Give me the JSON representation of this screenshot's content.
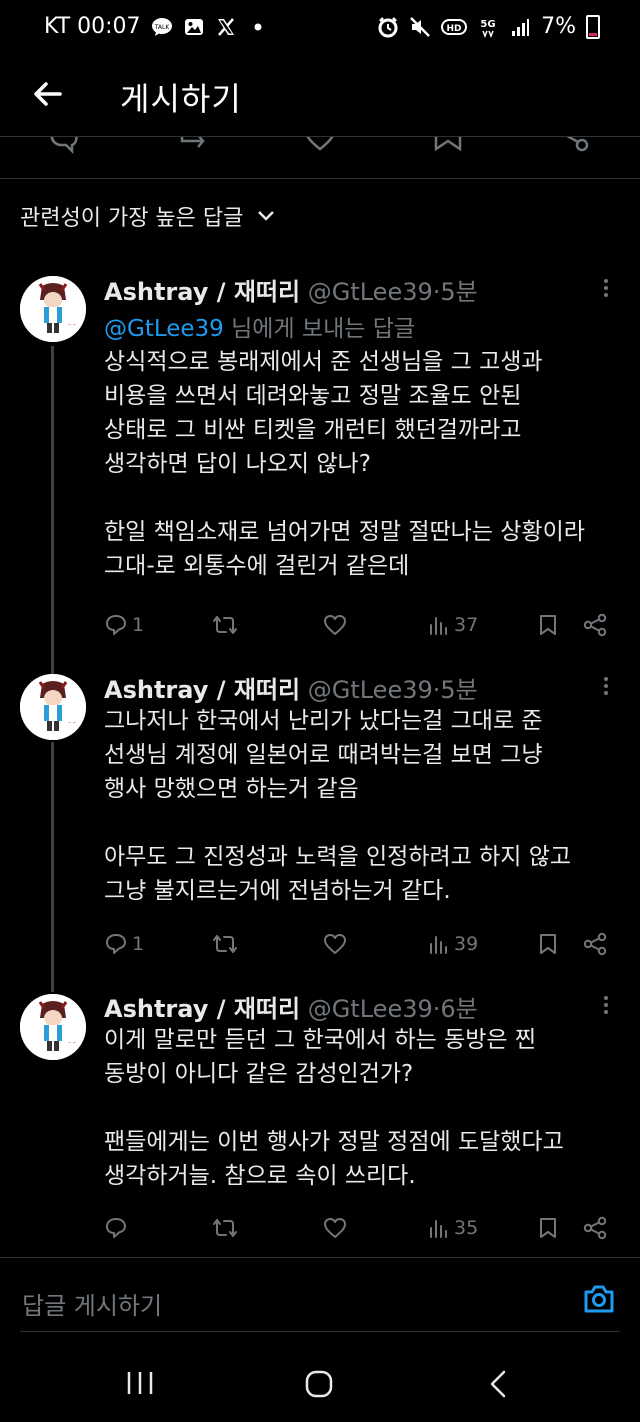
{
  "status_bar": {
    "carrier_time": "KT 00:07",
    "battery": "7%",
    "left_icons": [
      "talk-icon",
      "image-icon",
      "x-icon",
      "dot-icon"
    ],
    "right_icons": [
      "alarm-icon",
      "mute-icon",
      "hd-icon",
      "5g-icon",
      "signal-icon",
      "battery-icon"
    ]
  },
  "header": {
    "title": "게시하기"
  },
  "sort": {
    "label": "관련성이 가장 높은 답글"
  },
  "tweets": [
    {
      "name": "Ashtray / 재떠리",
      "handle": "@GtLee39",
      "dot": "·",
      "time": "5분",
      "reply_to": {
        "mention": "@GtLee39",
        "suffix": " 님에게 보내는 답글"
      },
      "lines": [
        "상식적으로 봉래제에서 준 선생님을 그 고생과",
        "비용을 쓰면서 데려와놓고 정말 조율도 안된",
        "상태로 그 비싼 티켓을 개런티 했던걸까라고",
        "생각하면 답이 나오지 않나?",
        "",
        "한일 책임소재로 넘어가면 정말 절딴나는 상황이라",
        "그대-로 외통수에 걸린거 같은데"
      ],
      "replies": "1",
      "views": "37"
    },
    {
      "name": "Ashtray / 재떠리",
      "handle": "@GtLee39",
      "dot": "·",
      "time": "5분",
      "lines": [
        "그나저나 한국에서 난리가 났다는걸 그대로 준",
        "선생님 계정에 일본어로 때려박는걸 보면 그냥",
        "행사 망했으면 하는거 같음",
        "",
        "아무도 그 진정성과 노력을 인정하려고 하지 않고",
        "그냥 불지르는거에 전념하는거 같다."
      ],
      "replies": "1",
      "views": "39"
    },
    {
      "name": "Ashtray / 재떠리",
      "handle": "@GtLee39",
      "dot": "·",
      "time": "6분",
      "lines": [
        "이게 말로만 듣던 그 한국에서 하는 동방은 찐",
        "동방이 아니다 같은 감성인건가?",
        "",
        "팬들에게는 이번 행사가 정말 정점에 도달했다고",
        "생각하거늘. 참으로 속이 쓰리다."
      ],
      "replies": "",
      "views": "35"
    }
  ],
  "reply_bar": {
    "placeholder": "답글 게시하기"
  },
  "colors": {
    "background": "#000000",
    "accent": "#1d9bf0",
    "muted": "#71767b",
    "text": "#e7e9ea"
  }
}
